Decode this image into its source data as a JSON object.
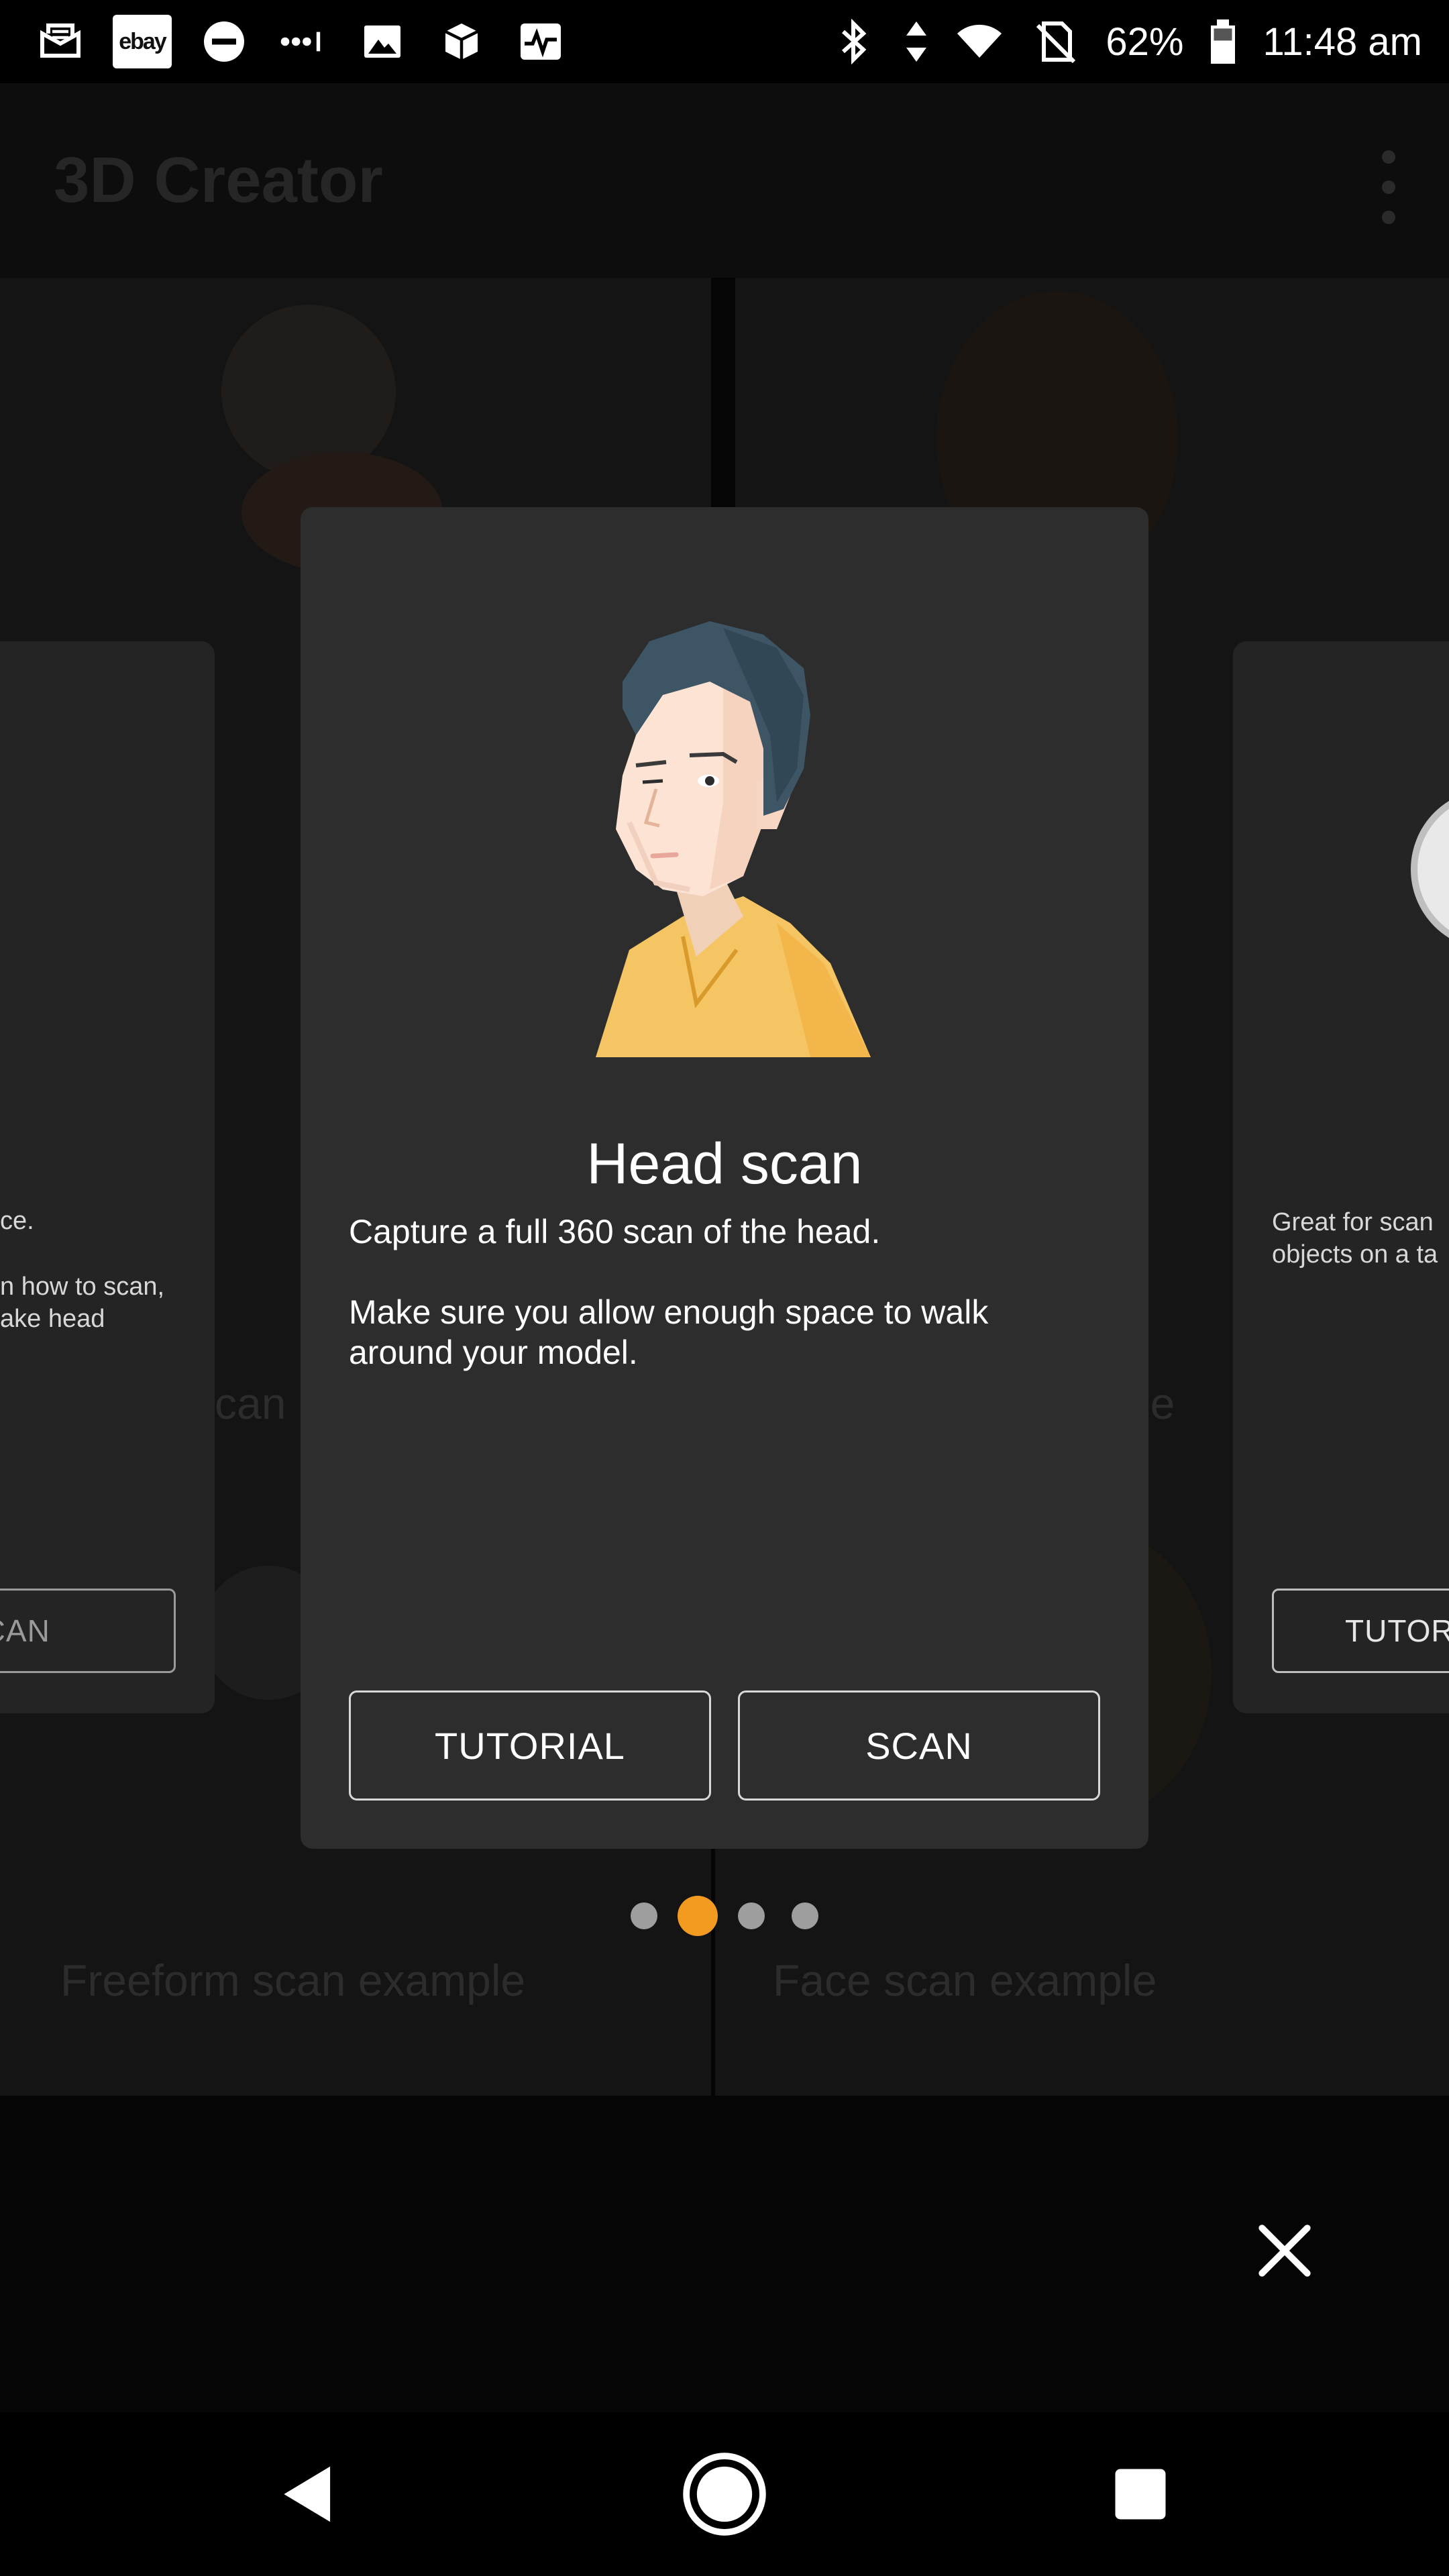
{
  "status_bar": {
    "battery": "62%",
    "time": "11:48 am",
    "ebay_label": "ebay",
    "left_icons": [
      "inbox-icon",
      "ebay-icon",
      "do-not-disturb-icon",
      "signal-dots-icon",
      "image-icon",
      "box-icon",
      "activity-icon"
    ],
    "right_icons": [
      "bluetooth-icon",
      "data-arrows-icon",
      "wifi-icon",
      "no-sim-icon",
      "battery-icon"
    ]
  },
  "app_bar": {
    "title": "3D Creator",
    "menu_icon": "overflow-menu-icon"
  },
  "background": {
    "captions": [
      "Freeform scan example",
      "Face scan example"
    ],
    "partial_captions": [
      "can",
      "le"
    ]
  },
  "left_card": {
    "text_1": "ce.",
    "text_2": "n how to scan,\nake head",
    "button": "SCAN"
  },
  "right_card": {
    "text": "Great for scan\nobjects on a ta",
    "button": "TUTORI"
  },
  "dialog": {
    "title": "Head scan",
    "body_1": "Capture a full 360 scan of the head.",
    "body_2": "Make sure you allow enough space to walk around your model.",
    "tutorial_button": "TUTORIAL",
    "scan_button": "SCAN",
    "illustration": "head-illustration"
  },
  "pager": {
    "count": 4,
    "active_index": 1,
    "active_color": "#f39a21",
    "inactive_color": "#9e9e9e"
  },
  "close_icon": "close-icon",
  "nav_bar": {
    "icons": [
      "back-icon",
      "home-icon",
      "recents-icon"
    ]
  }
}
